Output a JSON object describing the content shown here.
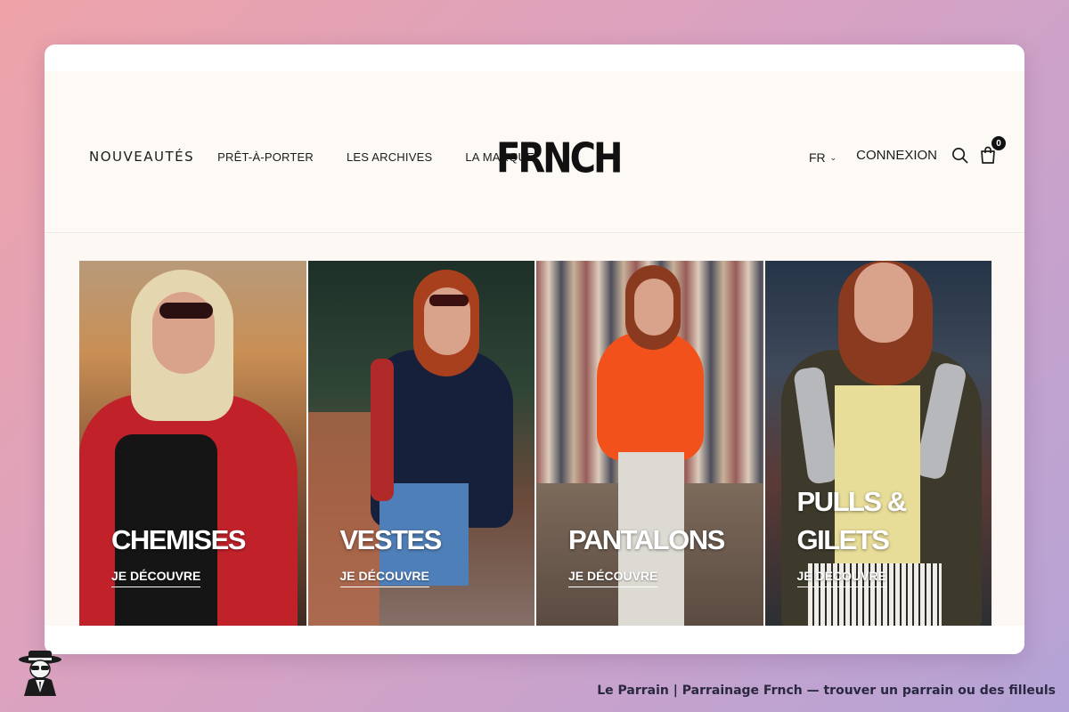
{
  "nav": {
    "main": "NOUVEAUTÉS",
    "items": [
      "PRÊT-À-PORTER",
      "LES ARCHIVES",
      "LA MARQUE"
    ]
  },
  "logo": "FRNCH",
  "header_right": {
    "language": "FR",
    "login": "CONNEXION",
    "search_icon": "search-icon",
    "cart_icon": "shopping-bag-icon",
    "cart_count": "0"
  },
  "categories": [
    {
      "title": "CHEMISES",
      "cta": "JE DÉCOUVRE"
    },
    {
      "title": "VESTES",
      "cta": "JE DÉCOUVRE"
    },
    {
      "title": "PANTALONS",
      "cta": "JE DÉCOUVRE"
    },
    {
      "title": "PULLS &",
      "title2": "GILETS",
      "cta": "JE DÉCOUVRE"
    }
  ],
  "scroll_top_icon": "chevron-up-icon",
  "caption": "Le Parrain | Parrainage Frnch — trouver un parrain ou des filleuls",
  "colors": {
    "header_bg": "#fdf9f5",
    "text": "#1c1c1c",
    "background_gradient": [
      "#eea3a8",
      "#d9a2c2",
      "#b4a3d6"
    ]
  }
}
